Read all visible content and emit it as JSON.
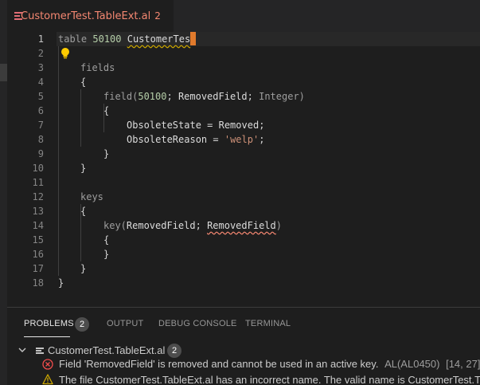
{
  "tab": {
    "filename": "CustomerTest.TableExt.al",
    "problem_count": "2",
    "colors": {
      "error_text": "#f48771",
      "dirty_dot": "#ffffff"
    }
  },
  "editor": {
    "line_numbers": [
      "1",
      "2",
      "3",
      "4",
      "5",
      "6",
      "7",
      "8",
      "9",
      "10",
      "11",
      "12",
      "13",
      "14",
      "15",
      "16",
      "17",
      "18"
    ],
    "active_line": "1",
    "lines": {
      "l1": {
        "kw": "table",
        "num": "50100",
        "name": "CustomerTes"
      },
      "l3": {
        "kw": "fields"
      },
      "l4": {
        "pun": "{"
      },
      "l5": {
        "kw": "field(",
        "num": "50100",
        "sep1": "; ",
        "name": "RemovedField",
        "sep2": "; ",
        "type": "Integer)"
      },
      "l6": {
        "pun": "{"
      },
      "l7": {
        "prop": "ObsoleteState",
        "eq": " = ",
        "val": "Removed",
        "end": ";"
      },
      "l8": {
        "prop": "ObsoleteReason",
        "eq": " = ",
        "val": "'welp'",
        "end": ";"
      },
      "l9": {
        "pun": "}"
      },
      "l10": {
        "pun": "}"
      },
      "l12": {
        "kw": "keys"
      },
      "l13": {
        "pun": "{"
      },
      "l14": {
        "kw": "key(",
        "name1": "RemovedField",
        "sep": "; ",
        "name2": "RemovedField",
        "close": ")"
      },
      "l15": {
        "pun": "{"
      },
      "l16": {
        "pun": "}"
      },
      "l17": {
        "pun": "}"
      },
      "l18": {
        "pun": "}"
      }
    },
    "colors": {
      "cursor": "#e07a2c",
      "lightbulb": "#ffcc00",
      "squiggle_error": "#f48771",
      "squiggle_warning": "#cca700"
    }
  },
  "panel": {
    "tabs": [
      {
        "label": "PROBLEMS",
        "badge": "2"
      },
      {
        "label": "OUTPUT"
      },
      {
        "label": "DEBUG CONSOLE"
      },
      {
        "label": "TERMINAL"
      }
    ],
    "group": {
      "filename": "CustomerTest.TableExt.al",
      "count": "2"
    },
    "problems": [
      {
        "severity": "error-icon",
        "message": "Field 'RemovedField' is removed and cannot be used in an active key.",
        "code": "AL(AL0450)",
        "location": "[14, 27]"
      },
      {
        "severity": "warning-icon",
        "message": "The file CustomerTest.TableExt.al has an incorrect name. The valid name is CustomerTest.Table"
      }
    ],
    "colors": {
      "error": "#f14c4c",
      "warning": "#cca700",
      "badge_bg": "#4d4d4d"
    }
  }
}
